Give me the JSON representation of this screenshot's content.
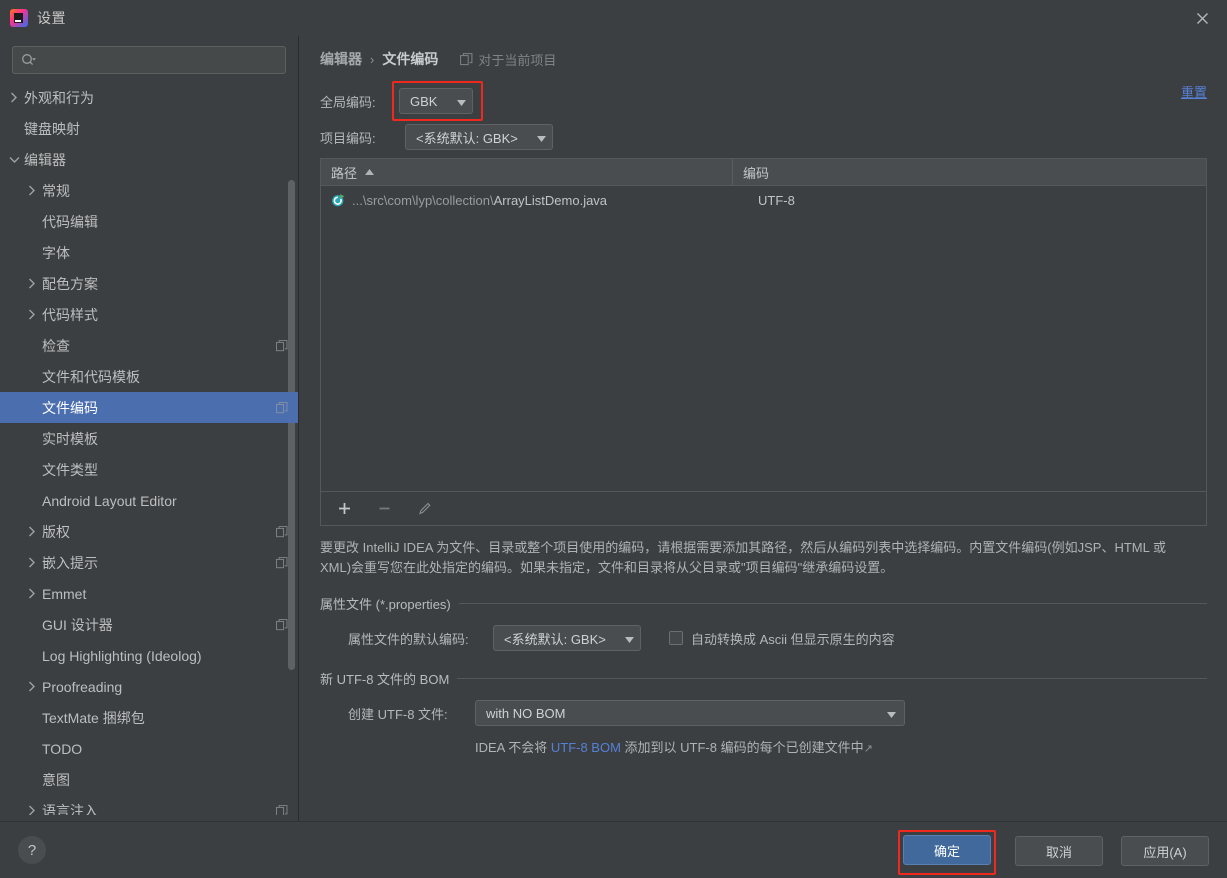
{
  "window": {
    "title": "设置",
    "app_icon": "intellij-idea-logo",
    "close_icon": "close-icon"
  },
  "sidebar": {
    "search": {
      "placeholder": "",
      "value": "",
      "icon": "search-icon"
    },
    "items": [
      {
        "label": "外观和行为",
        "level": 1,
        "arrow": "collapsed",
        "copy_icon": false,
        "selected": false
      },
      {
        "label": "键盘映射",
        "level": 1,
        "arrow": "none",
        "copy_icon": false,
        "selected": false
      },
      {
        "label": "编辑器",
        "level": 1,
        "arrow": "expanded",
        "copy_icon": false,
        "selected": false
      },
      {
        "label": "常规",
        "level": 2,
        "arrow": "collapsed",
        "copy_icon": false,
        "selected": false
      },
      {
        "label": "代码编辑",
        "level": 2,
        "arrow": "none",
        "copy_icon": false,
        "selected": false
      },
      {
        "label": "字体",
        "level": 2,
        "arrow": "none",
        "copy_icon": false,
        "selected": false
      },
      {
        "label": "配色方案",
        "level": 2,
        "arrow": "collapsed",
        "copy_icon": false,
        "selected": false
      },
      {
        "label": "代码样式",
        "level": 2,
        "arrow": "collapsed",
        "copy_icon": false,
        "selected": false
      },
      {
        "label": "检查",
        "level": 2,
        "arrow": "none",
        "copy_icon": true,
        "selected": false
      },
      {
        "label": "文件和代码模板",
        "level": 2,
        "arrow": "none",
        "copy_icon": false,
        "selected": false
      },
      {
        "label": "文件编码",
        "level": 2,
        "arrow": "none",
        "copy_icon": true,
        "selected": true
      },
      {
        "label": "实时模板",
        "level": 2,
        "arrow": "none",
        "copy_icon": false,
        "selected": false
      },
      {
        "label": "文件类型",
        "level": 2,
        "arrow": "none",
        "copy_icon": false,
        "selected": false
      },
      {
        "label": "Android Layout Editor",
        "level": 2,
        "arrow": "none",
        "copy_icon": false,
        "selected": false
      },
      {
        "label": "版权",
        "level": 2,
        "arrow": "collapsed",
        "copy_icon": true,
        "selected": false
      },
      {
        "label": "嵌入提示",
        "level": 2,
        "arrow": "collapsed",
        "copy_icon": true,
        "selected": false
      },
      {
        "label": "Emmet",
        "level": 2,
        "arrow": "collapsed",
        "copy_icon": false,
        "selected": false
      },
      {
        "label": "GUI 设计器",
        "level": 2,
        "arrow": "none",
        "copy_icon": true,
        "selected": false
      },
      {
        "label": "Log Highlighting (Ideolog)",
        "level": 2,
        "arrow": "none",
        "copy_icon": false,
        "selected": false
      },
      {
        "label": "Proofreading",
        "level": 2,
        "arrow": "collapsed",
        "copy_icon": false,
        "selected": false
      },
      {
        "label": "TextMate 捆绑包",
        "level": 2,
        "arrow": "none",
        "copy_icon": false,
        "selected": false
      },
      {
        "label": "TODO",
        "level": 2,
        "arrow": "none",
        "copy_icon": false,
        "selected": false
      },
      {
        "label": "意图",
        "level": 2,
        "arrow": "none",
        "copy_icon": false,
        "selected": false
      },
      {
        "label": "语言注入",
        "level": 2,
        "arrow": "collapsed",
        "copy_icon": true,
        "selected": false
      }
    ]
  },
  "header": {
    "breadcrumb_parent": "编辑器",
    "breadcrumb_sep": "›",
    "breadcrumb_current": "文件编码",
    "scope_label": "对于当前项目",
    "scope_icon": "copy-scope-icon",
    "reset_label": "重置"
  },
  "encodings": {
    "global_label": "全局编码:",
    "global_value": "GBK",
    "project_label": "项目编码:",
    "project_value": "<系统默认: GBK>"
  },
  "table": {
    "columns": [
      "路径",
      "编码"
    ],
    "sort_column": "路径",
    "sort_direction": "asc",
    "rows": [
      {
        "icon": "java-class-run-icon",
        "path_prefix": "...\\src\\com\\lyp\\collection\\",
        "path_file": "ArrayListDemo.java",
        "encoding": "UTF-8"
      }
    ],
    "toolbar": {
      "add": "+",
      "remove": "−",
      "edit": "✎"
    }
  },
  "description": "要更改 IntelliJ IDEA 为文件、目录或整个项目使用的编码，请根据需要添加其路径，然后从编码列表中选择编码。内置文件编码(例如JSP、HTML 或 XML)会重写您在此处指定的编码。如果未指定，文件和目录将从父目录或\"项目编码\"继承编码设置。",
  "properties_section": {
    "title": "属性文件 (*.properties)",
    "default_encoding_label": "属性文件的默认编码:",
    "default_encoding_value": "<系统默认: GBK>",
    "transparent_checkbox_label": "自动转换成 Ascii 但显示原生的内容",
    "transparent_checkbox_checked": false
  },
  "bom_section": {
    "title": "新 UTF-8 文件的 BOM",
    "create_label": "创建 UTF-8 文件:",
    "create_value": "with NO BOM",
    "note_prefix": "IDEA 不会将 ",
    "note_link": "UTF-8 BOM",
    "note_suffix": " 添加到以 UTF-8 编码的每个已创建文件中",
    "note_external_icon": "↗"
  },
  "footer": {
    "help_label": "?",
    "ok_label": "确定",
    "cancel_label": "取消",
    "apply_label": "应用(A)"
  },
  "colors": {
    "background": "#3c3f41",
    "selection_blue": "#4b6eaf",
    "link_blue": "#5680d6",
    "highlight_red": "#f0281e",
    "primary_button": "#41699c"
  }
}
